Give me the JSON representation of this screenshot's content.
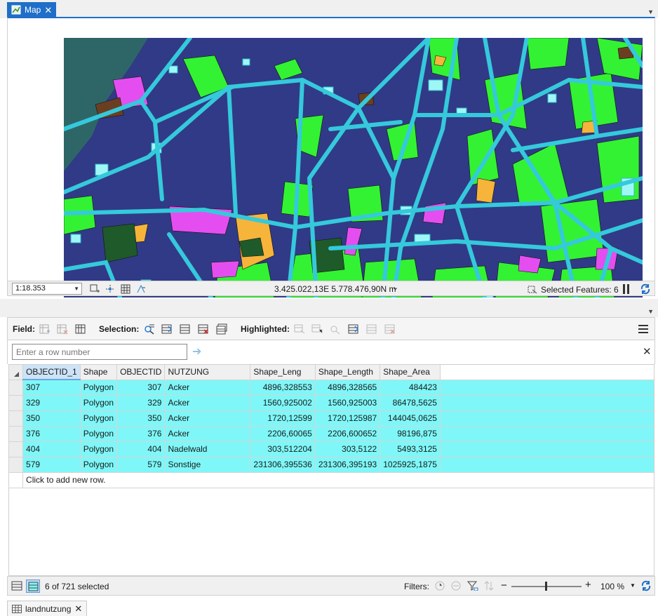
{
  "map_tab": {
    "label": "Map",
    "close": "✕"
  },
  "map_status": {
    "scale": "1:18.353",
    "coordinates": "3.425.022,13E 5.778.476,90N m",
    "selected_features": "Selected Features: 6"
  },
  "attr_tab": {
    "label": "landnutzung",
    "close": "✕"
  },
  "toolbar": {
    "field_label": "Field:",
    "selection_label": "Selection:",
    "highlighted_label": "Highlighted:"
  },
  "rownum": {
    "placeholder": "Enter a row number"
  },
  "table": {
    "columns": [
      "OBJECTID_1",
      "Shape",
      "OBJECTID",
      "NUTZUNG",
      "Shape_Leng",
      "Shape_Length",
      "Shape_Area"
    ],
    "rows": [
      [
        "307",
        "Polygon",
        "307",
        "Acker",
        "4896,328553",
        "4896,328565",
        "484423"
      ],
      [
        "329",
        "Polygon",
        "329",
        "Acker",
        "1560,925002",
        "1560,925003",
        "86478,5625"
      ],
      [
        "350",
        "Polygon",
        "350",
        "Acker",
        "1720,12599",
        "1720,125987",
        "144045,0625"
      ],
      [
        "376",
        "Polygon",
        "376",
        "Acker",
        "2206,60065",
        "2206,600652",
        "98196,875"
      ],
      [
        "404",
        "Polygon",
        "404",
        "Nadelwald",
        "303,512204",
        "303,5122",
        "5493,3125"
      ],
      [
        "579",
        "Polygon",
        "579",
        "Sonstige",
        "231306,395536",
        "231306,395193",
        "1025925,1875"
      ]
    ],
    "add_row": "Click to add new row."
  },
  "bottom_bar": {
    "selection_count": "6 of 721 selected",
    "filters_label": "Filters:",
    "zoom_minus": "−",
    "zoom_plus": "+",
    "zoom_percent": "100 %"
  },
  "colors": {
    "accent": "#1f6fc9",
    "selected_row": "#7ff7f8",
    "map_roads": "#35c9dc",
    "map_landuse_dark": "#313a86",
    "map_green": "#33f233",
    "map_magenta": "#e44ef0",
    "map_orange": "#f6b43a",
    "map_darkgreen": "#1f5a2a",
    "map_brown": "#6b3e21",
    "map_water": "#2e6668"
  }
}
